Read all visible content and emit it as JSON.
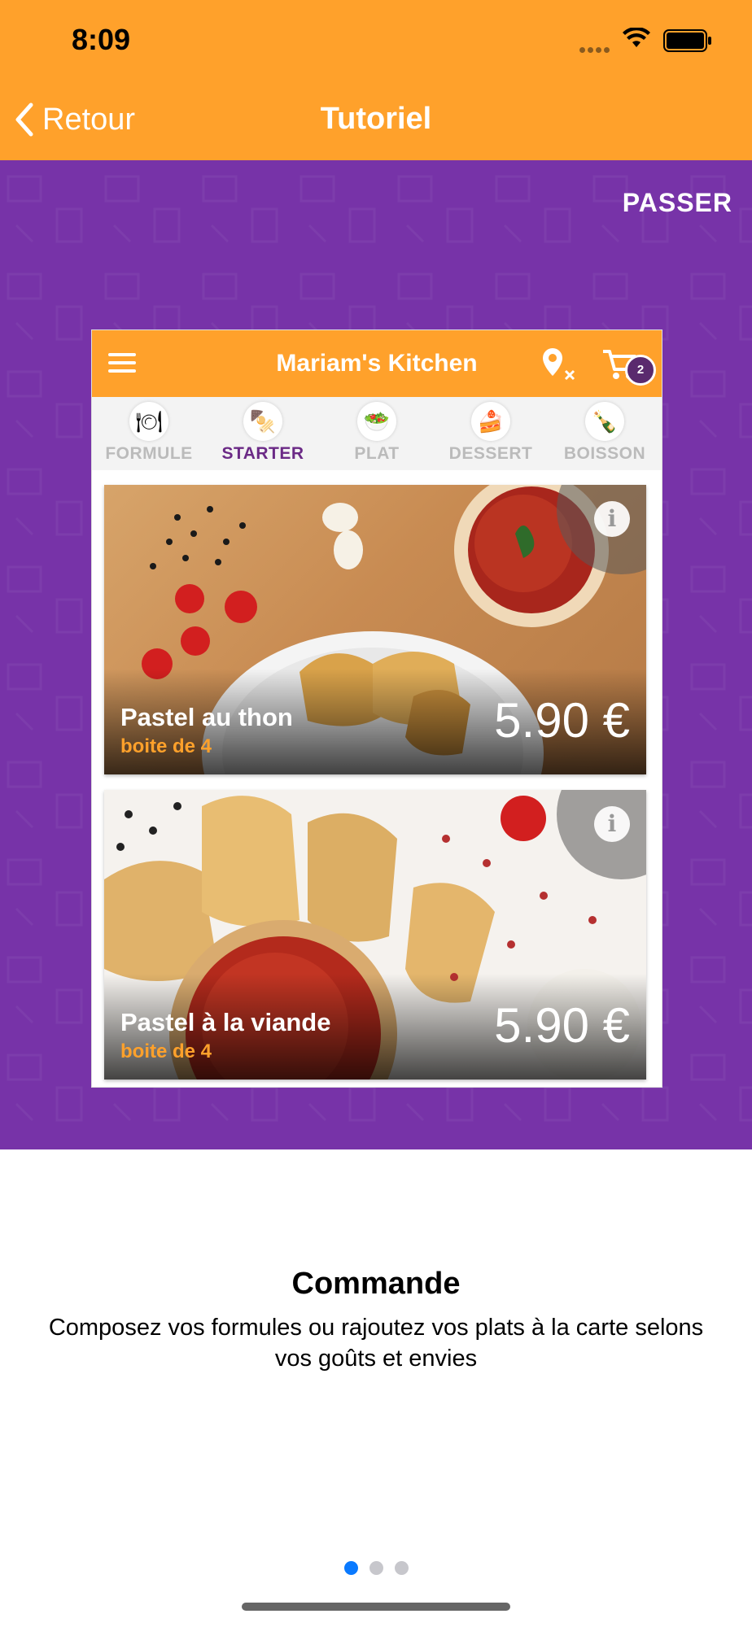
{
  "status_bar": {
    "time": "8:09"
  },
  "nav": {
    "back_label": "Retour",
    "title": "Tutoriel"
  },
  "tutorial": {
    "skip_label": "PASSER"
  },
  "preview": {
    "app_title": "Mariam's Kitchen",
    "cart_count": "2",
    "categories": [
      {
        "label": "FORMULE",
        "icon": "🍽"
      },
      {
        "label": "STARTER",
        "icon": "🍢"
      },
      {
        "label": "PLAT",
        "icon": "🥗"
      },
      {
        "label": "DESSERT",
        "icon": "🍰"
      },
      {
        "label": "BOISSON",
        "icon": "🍾"
      }
    ],
    "active_category": "STARTER",
    "items": [
      {
        "name": "Pastel au thon",
        "sub": "boite de 4",
        "price": "5.90 €",
        "info": "i"
      },
      {
        "name": "Pastel à la viande",
        "sub": "boite de 4",
        "price": "5.90 €",
        "info": "i"
      }
    ]
  },
  "page": {
    "heading": "Commande",
    "description": "Composez vos formules ou rajoutez vos plats à la carte selons vos goûts et envies",
    "pager_total": 3,
    "pager_active": 0
  },
  "colors": {
    "orange": "#FFA12B",
    "purple": "#7733A8",
    "pager_active": "#0A7AFF"
  }
}
